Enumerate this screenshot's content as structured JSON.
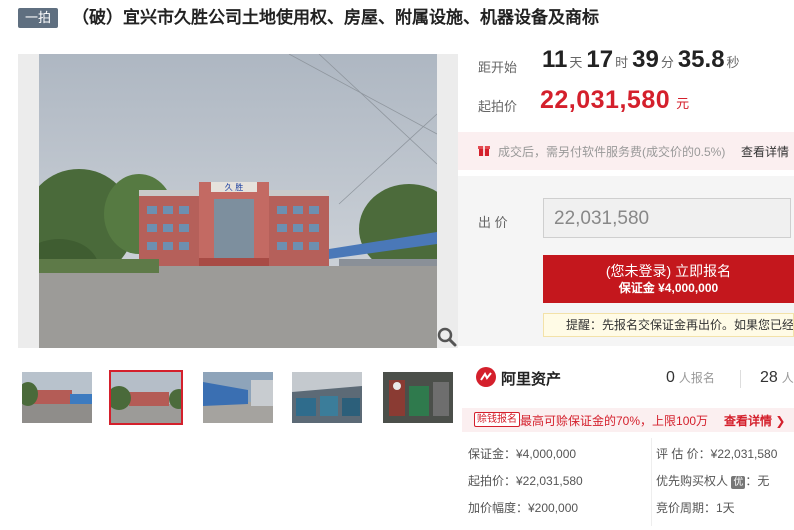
{
  "header": {
    "badge": "一拍",
    "title": "（破）宜兴市久胜公司土地使用权、房屋、附属设施、机器设备及商标"
  },
  "gallery": {
    "sign_text": "久 胜"
  },
  "auction": {
    "countdown_label": "距开始",
    "days": "11",
    "days_unit": "天",
    "hours": "17",
    "hours_unit": "时",
    "minutes": "39",
    "minutes_unit": "分",
    "seconds": "35.8",
    "seconds_unit": "秒",
    "start_price_label": "起拍价",
    "start_price": "22,031,580",
    "start_price_unit": "元"
  },
  "fee_notice": {
    "text": "成交后，需另付软件服务费(成交价的0.5%)",
    "link": "查看详情"
  },
  "bid": {
    "label": "出 价",
    "input_value": "22,031,580",
    "register_line1": "(您未登录) 立即报名",
    "register_line2": "保证金 ¥4,000,000",
    "tip": "提醒：先报名交保证金再出价。如果您已经"
  },
  "stats": {
    "platform": "阿里资产",
    "registered_count": "0",
    "registered_label": "人报名",
    "reminder_count": "28",
    "reminder_label": "人"
  },
  "promo": {
    "tag": "赊钱报名",
    "text": "最高可赊保证金的70%，上限100万",
    "link": "查看详情 ❯"
  },
  "details": {
    "deposit": "保证金：¥4,000,000",
    "start_price": "起拍价：¥22,031,580",
    "increment": "加价幅度：¥200,000",
    "valuation": "评 估 价：¥22,031,580",
    "priority_label": "优先购买权人",
    "priority_badge": "优",
    "priority_value": "：无",
    "cycle": "竞价周期：1天"
  },
  "colors": {
    "accent": "#c4171d",
    "price": "#d4202c",
    "badge": "#5f6f80"
  }
}
